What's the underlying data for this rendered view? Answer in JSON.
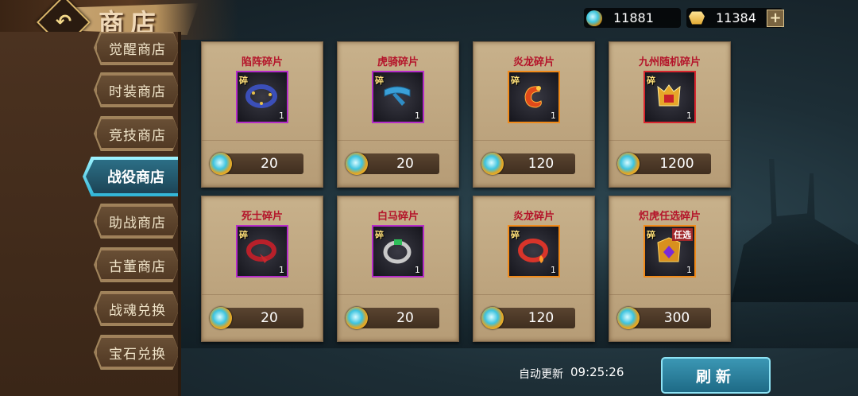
{
  "header": {
    "title": "商店",
    "gems": "11881",
    "gold": "11384"
  },
  "sidebar": {
    "tabs": [
      {
        "label": "觉醒商店"
      },
      {
        "label": "时装商店"
      },
      {
        "label": "竞技商店"
      },
      {
        "label": "战役商店",
        "active": true
      },
      {
        "label": "助战商店"
      },
      {
        "label": "古董商店"
      },
      {
        "label": "战魂兑换"
      },
      {
        "label": "宝石兑换"
      }
    ]
  },
  "shop": {
    "items": [
      {
        "name": "陷阵碎片",
        "quantity": "1",
        "price": "20",
        "frame": "purple",
        "art": "purple-ring"
      },
      {
        "name": "虎骑碎片",
        "quantity": "1",
        "price": "20",
        "frame": "purple",
        "art": "blue-belt"
      },
      {
        "name": "炎龙碎片",
        "quantity": "1",
        "price": "120",
        "frame": "orange",
        "art": "fire-dragon"
      },
      {
        "name": "九州随机碎片",
        "quantity": "1",
        "price": "1200",
        "frame": "red",
        "art": "golden-armor"
      },
      {
        "name": "死士碎片",
        "quantity": "1",
        "price": "20",
        "frame": "purple",
        "art": "red-belt"
      },
      {
        "name": "白马碎片",
        "quantity": "1",
        "price": "20",
        "frame": "purple",
        "art": "green-ring"
      },
      {
        "name": "炎龙碎片",
        "quantity": "1",
        "price": "120",
        "frame": "orange",
        "art": "red-ring"
      },
      {
        "name": "炽虎任选碎片",
        "quantity": "1",
        "price": "300",
        "frame": "orange",
        "art": "tiger-armor",
        "tag": "任选"
      }
    ],
    "fragment_tag": "碎"
  },
  "footer": {
    "auto_refresh_label": "自动更新",
    "refresh_time": "09:25:26",
    "refresh_button": "刷新"
  },
  "colors": {
    "card_bg": "#c8b18b",
    "item_name": "#b4142a",
    "active_tab": "#2fb4d6"
  }
}
